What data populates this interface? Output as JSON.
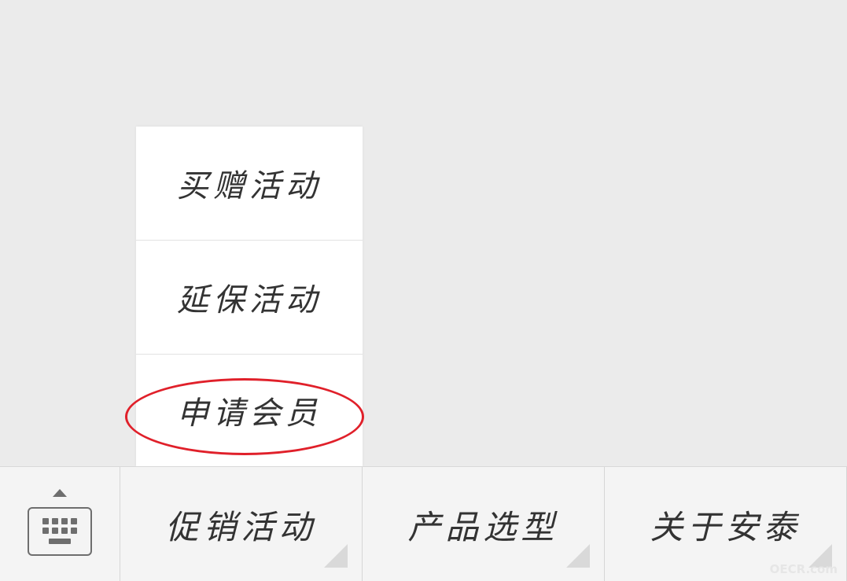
{
  "popup_menu": {
    "items": [
      {
        "label": "买赠活动"
      },
      {
        "label": "延保活动"
      },
      {
        "label": "申请会员"
      }
    ],
    "highlighted_item": "申请会员",
    "highlight_color": "#e0202a"
  },
  "bottom_menu": {
    "keyboard_toggle_icon": "keyboard-icon",
    "items": [
      {
        "label": "促销活动"
      },
      {
        "label": "产品选型"
      },
      {
        "label": "关于安泰"
      }
    ]
  },
  "watermark": "OECR.com"
}
